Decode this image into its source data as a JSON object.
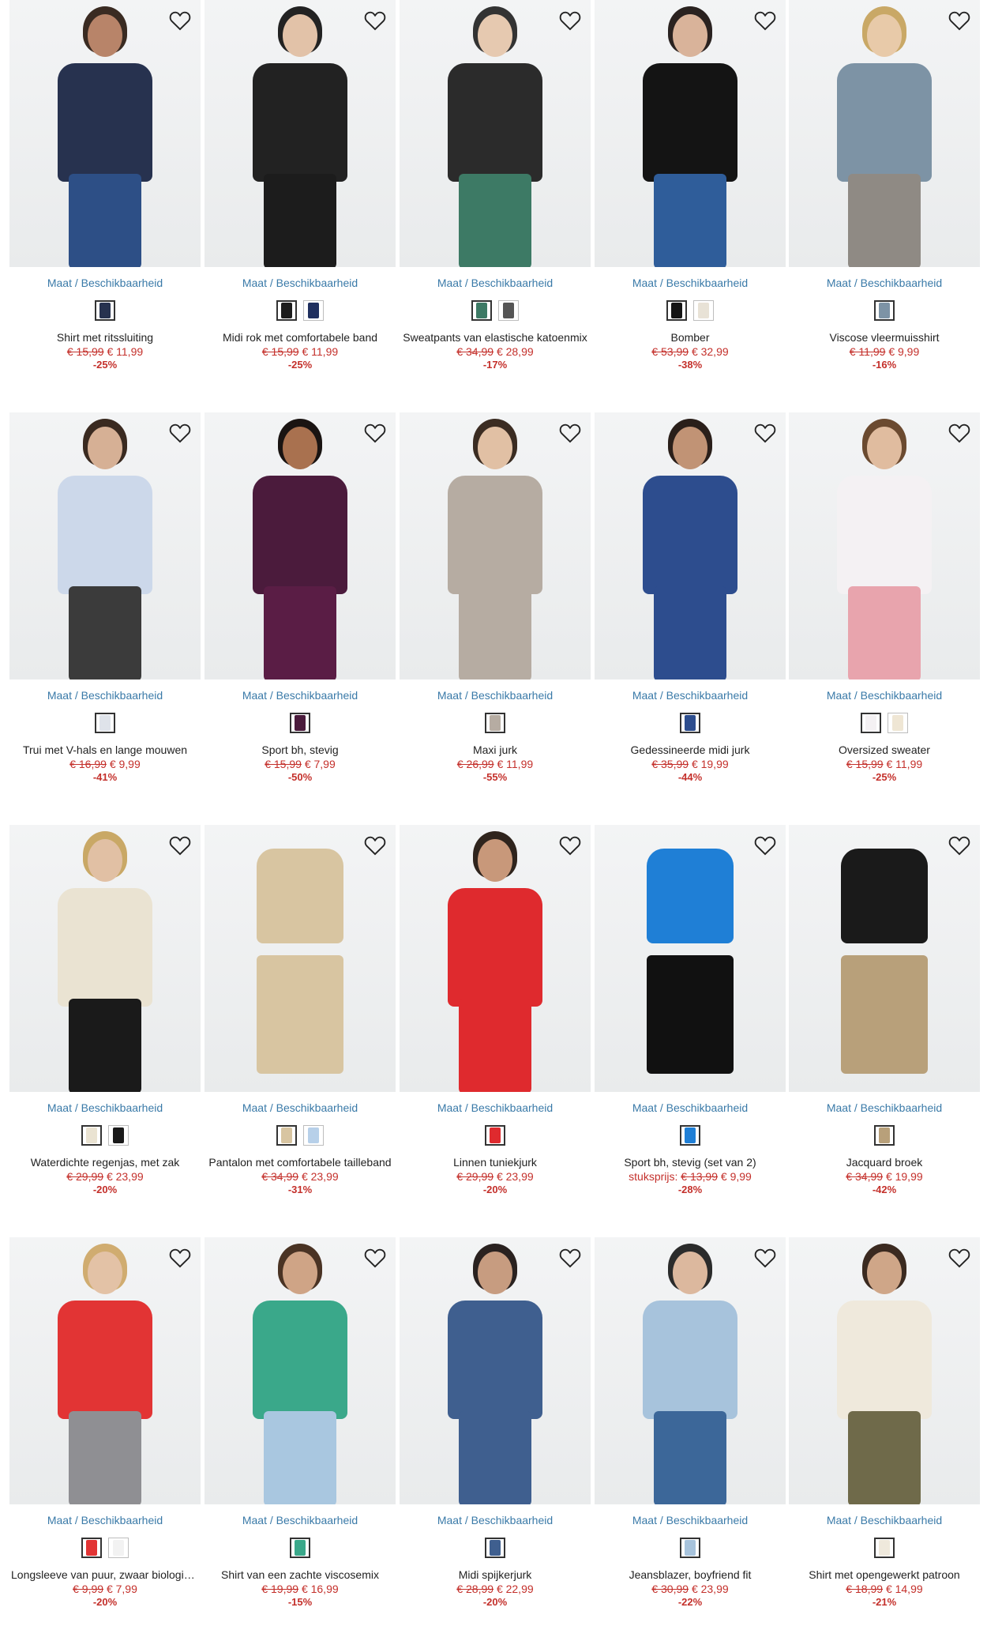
{
  "common": {
    "size_link": "Maat / Beschikbaarheid"
  },
  "products": [
    {
      "title": "Shirt met ritssluiting",
      "old": "€ 15,99",
      "new": "€ 11,99",
      "discount": "-25%",
      "top": "#27324f",
      "bottom": "#2d4f86",
      "skin": "#b88469",
      "hair": "#3a2b22",
      "swatches": [
        "#27324f"
      ]
    },
    {
      "title": "Midi rok met comfortabele band",
      "old": "€ 15,99",
      "new": "€ 11,99",
      "discount": "-25%",
      "top": "#222222",
      "bottom": "#1c1c1c",
      "skin": "#e2c2a8",
      "hair": "#222222",
      "swatches": [
        "#1c1c1c",
        "#1f2f5e"
      ]
    },
    {
      "title": "Sweatpants van elastische katoenmix",
      "old": "€ 34,99",
      "new": "€ 28,99",
      "discount": "-17%",
      "top": "#2b2b2b",
      "bottom": "#3d7a65",
      "skin": "#e6c9b0",
      "hair": "#333333",
      "swatches": [
        "#3d7a65",
        "#555555"
      ]
    },
    {
      "title": "Bomber",
      "old": "€ 53,99",
      "new": "€ 32,99",
      "discount": "-38%",
      "top": "#141414",
      "bottom": "#2f5d9a",
      "skin": "#d9b39a",
      "hair": "#2a2220",
      "swatches": [
        "#141414",
        "#e8e2d6"
      ]
    },
    {
      "title": "Viscose vleermuisshirt",
      "old": "€ 11,99",
      "new": "€ 9,99",
      "discount": "-16%",
      "top": "#7d93a5",
      "bottom": "#8f8a84",
      "skin": "#e8caa9",
      "hair": "#c9a866",
      "swatches": [
        "#7d93a5"
      ]
    },
    {
      "title": "Trui met V-hals en lange mouwen",
      "old": "€ 16,99",
      "new": "€ 9,99",
      "discount": "-41%",
      "top": "#ccd8ea",
      "bottom": "#3b3b3b",
      "skin": "#d6b095",
      "hair": "#3a2a20",
      "swatches": [
        "#dfe3ea"
      ]
    },
    {
      "title": "Sport bh, stevig",
      "old": "€ 15,99",
      "new": "€ 7,99",
      "discount": "-50%",
      "top": "#4b1b3c",
      "bottom": "#5a1d45",
      "skin": "#a9714f",
      "hair": "#1a1412",
      "swatches": [
        "#4b1b3c"
      ]
    },
    {
      "title": "Maxi jurk",
      "old": "€ 26,99",
      "new": "€ 11,99",
      "discount": "-55%",
      "top": "#b6aca2",
      "bottom": "#b6aca2",
      "skin": "#e1c0a4",
      "hair": "#3b2c22",
      "swatches": [
        "#b6aca2"
      ]
    },
    {
      "title": "Gedessineerde midi jurk",
      "old": "€ 35,99",
      "new": "€ 19,99",
      "discount": "-44%",
      "top": "#2d4d8e",
      "bottom": "#2d4d8e",
      "skin": "#c19375",
      "hair": "#2a1f1a",
      "swatches": [
        "#2d4d8e"
      ]
    },
    {
      "title": "Oversized sweater",
      "old": "€ 15,99",
      "new": "€ 11,99",
      "discount": "-25%",
      "top": "#f4f1f3",
      "bottom": "#e8a4ad",
      "skin": "#e0bc9f",
      "hair": "#6b4a30",
      "swatches": [
        "#f4f1f3",
        "#efe6d4"
      ]
    },
    {
      "title": "Waterdichte regenjas, met zak",
      "old": "€ 29,99",
      "new": "€ 23,99",
      "discount": "-20%",
      "top": "#eae3d2",
      "bottom": "#1a1a1a",
      "skin": "#e1c0a4",
      "hair": "#c9a866",
      "swatches": [
        "#eae3d2",
        "#1a1a1a"
      ]
    },
    {
      "title": "Pantalon met comfortabele tailleband",
      "old": "€ 34,99",
      "new": "€ 23,99",
      "discount": "-31%",
      "top": "#d8c5a1",
      "bottom": "#d8c5a1",
      "skin": "#eef0f1",
      "hair": "#eef0f1",
      "swatches": [
        "#d8c5a1",
        "#b7d0e9"
      ]
    },
    {
      "title": "Linnen tuniekjurk",
      "old": "€ 29,99",
      "new": "€ 23,99",
      "discount": "-20%",
      "top": "#df2a2e",
      "bottom": "#df2a2e",
      "skin": "#c8987a",
      "hair": "#2f241d",
      "swatches": [
        "#df2a2e"
      ]
    },
    {
      "title": "Sport bh, stevig (set van 2)",
      "unit": "stuksprijs:",
      "old": "€ 13,99",
      "new": "€ 9,99",
      "discount": "-28%",
      "top": "#1f7fd6",
      "bottom": "#111111",
      "skin": "#ffffff",
      "hair": "#ffffff",
      "swatches": [
        "#1f7fd6"
      ]
    },
    {
      "title": "Jacquard broek",
      "old": "€ 34,99",
      "new": "€ 19,99",
      "discount": "-42%",
      "top": "#1a1a1a",
      "bottom": "#b8a07a",
      "skin": "#eef0f1",
      "hair": "#eef0f1",
      "swatches": [
        "#b8a07a"
      ]
    },
    {
      "title": "Longsleeve van puur, zwaar biologisch katoen",
      "old": "€ 9,99",
      "new": "€ 7,99",
      "discount": "-20%",
      "top": "#e23434",
      "bottom": "#8f8f93",
      "skin": "#e3c2a6",
      "hair": "#d0ac70",
      "swatches": [
        "#e23434",
        "#f2f2f2"
      ]
    },
    {
      "title": "Shirt van een zachte viscosemix",
      "old": "€ 19,99",
      "new": "€ 16,99",
      "discount": "-15%",
      "top": "#3aa88a",
      "bottom": "#a9c7e0",
      "skin": "#cfa486",
      "hair": "#4a3324",
      "swatches": [
        "#3aa88a"
      ]
    },
    {
      "title": "Midi spijkerjurk",
      "old": "€ 28,99",
      "new": "€ 22,99",
      "discount": "-20%",
      "top": "#3f5f8f",
      "bottom": "#3f5f8f",
      "skin": "#c79c80",
      "hair": "#2a2220",
      "swatches": [
        "#3f5f8f"
      ]
    },
    {
      "title": "Jeansblazer, boyfriend fit",
      "old": "€ 30,99",
      "new": "€ 23,99",
      "discount": "-22%",
      "top": "#a7c3dc",
      "bottom": "#3c6799",
      "skin": "#dcb89e",
      "hair": "#2b2b2b",
      "swatches": [
        "#a7c3dc"
      ]
    },
    {
      "title": "Shirt met opengewerkt patroon",
      "old": "€ 18,99",
      "new": "€ 14,99",
      "discount": "-21%",
      "top": "#efe9dc",
      "bottom": "#6f6a4a",
      "skin": "#cfa688",
      "hair": "#3b2a20",
      "swatches": [
        "#efe9dc"
      ]
    }
  ]
}
